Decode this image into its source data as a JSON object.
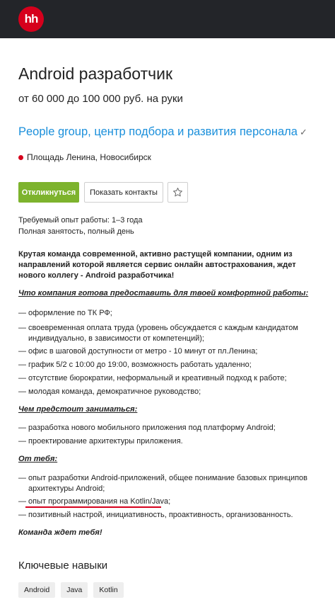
{
  "header": {
    "logo_text": "hh",
    "logo_color": "#d6001c",
    "bar_color": "#232529"
  },
  "vacancy": {
    "title": "Android разработчик",
    "salary": "от 60 000 до 100 000 руб. на руки",
    "company": "People group, центр подбора и развития персонала",
    "verified_icon": "check-icon",
    "location": "Площадь Ленина, Новосибирск",
    "accent_green": "#7db32d",
    "link_blue": "#1a8fdb"
  },
  "actions": {
    "respond_label": "Откликнуться",
    "contacts_label": "Показать контакты",
    "favorite_icon": "star-icon"
  },
  "meta": {
    "experience": "Требуемый опыт работы: 1–3 года",
    "employment": "Полная занятость, полный день"
  },
  "description": {
    "intro": "Крутая команда современной, активно растущей компании, одним из направлений которой является сервис онлайн автострахования, ждет нового коллегу - Android разработчика!",
    "section1": {
      "title": "Что компания готова предоставить для твоей комфортной работы:",
      "items": [
        "оформление по ТК РФ;",
        "своевременная оплата труда (уровень обсуждается с каждым кандидатом индивидуально, в зависимости от компетенций);",
        "офис в шаговой доступности от метро - 10 минут от пл.Ленина;",
        "график 5/2 с 10:00 до 19:00, возможность работать удаленно;",
        "отсутствие бюрократии, неформальный и креативный подход к работе;",
        "молодая команда, демократичное руководство;"
      ]
    },
    "section2": {
      "title": "Чем предстоит заниматься:",
      "items": [
        "разработка нового мобильного приложения под платформу Android;",
        "проектирование архитектуры приложения."
      ]
    },
    "section3": {
      "title": "От тебя:",
      "items": [
        "опыт разработки Android-приложений, общее понимание базовых принципов архитектуры Android;",
        "опыт программирования на Kotlin/Java;",
        "позитивный настрой, инициативность, проактивность, организованность."
      ]
    },
    "closing": "Команда ждет тебя!",
    "dash": "—"
  },
  "skills": {
    "title": "Ключевые навыки",
    "tags": [
      "Android",
      "Java",
      "Kotlin"
    ]
  }
}
